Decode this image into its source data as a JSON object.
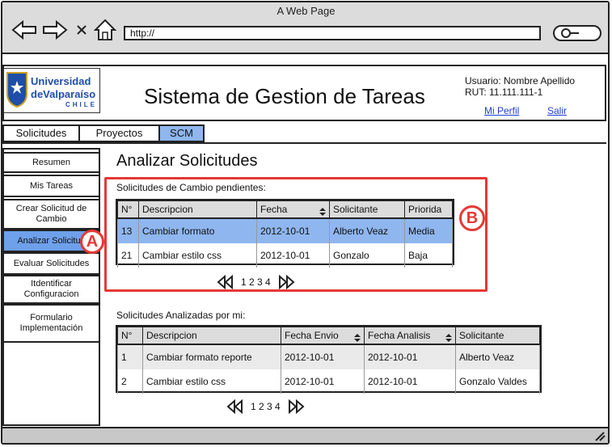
{
  "browser": {
    "window_title": "A Web Page",
    "url": "http://"
  },
  "header": {
    "logo_line1": "Universidad",
    "logo_line2": "deValparaíso",
    "logo_line3": "CHILE",
    "app_title": "Sistema de Gestion de Tareas",
    "user_name": "Usuario: Nombre Apellido",
    "user_rut": "RUT: 11.111.111-1",
    "profile_link": "Mi Perfil",
    "logout_link": "Salir"
  },
  "tabs": [
    {
      "label": "Solicitudes"
    },
    {
      "label": "Proyectos"
    },
    {
      "label": "SCM"
    }
  ],
  "sidebar": {
    "items": [
      {
        "label": "Resumen"
      },
      {
        "label": "Mis Tareas"
      },
      {
        "label": "Crear Solicitud de Cambio"
      },
      {
        "label": "Analizar Solicitud"
      },
      {
        "label": "Evaluar Solicitudes"
      },
      {
        "label": "Itdentificar Configuracion"
      },
      {
        "label": "Formulario Implementación"
      }
    ]
  },
  "main": {
    "title": "Analizar Solicitudes",
    "pending": {
      "caption": "Solicitudes de Cambio pendientes:",
      "columns": [
        "N°",
        "Descripcion",
        "Fecha",
        "Solicitante",
        "Priorida"
      ],
      "rows": [
        [
          "13",
          "Cambiar formato",
          "2012-10-01",
          "Alberto Veaz",
          "Media"
        ],
        [
          "21",
          "Cambiar estilo css",
          "2012-10-01",
          "Gonzalo",
          "Baja"
        ]
      ],
      "pages": "1 2 3 4"
    },
    "analyzed": {
      "caption": "Solicitudes Analizadas por mi:",
      "columns": [
        "N°",
        "Descripcion",
        "Fecha Envio",
        "Fecha Analisis",
        "Solicitante"
      ],
      "rows": [
        [
          "1",
          "Cambiar formato reporte",
          "2012-10-01",
          "2012-10-01",
          "Alberto Veaz"
        ],
        [
          "2",
          "Cambiar estilo css",
          "2012-10-01",
          "2012-10-01",
          "Gonzalo Valdes"
        ]
      ],
      "pages": "1 2 3 4"
    }
  },
  "annotations": {
    "a": "A",
    "b": "B"
  },
  "colors": {
    "selected_row": "#8fb6ee",
    "active_tab": "#8fb6ee",
    "annotation": "#e53935"
  }
}
